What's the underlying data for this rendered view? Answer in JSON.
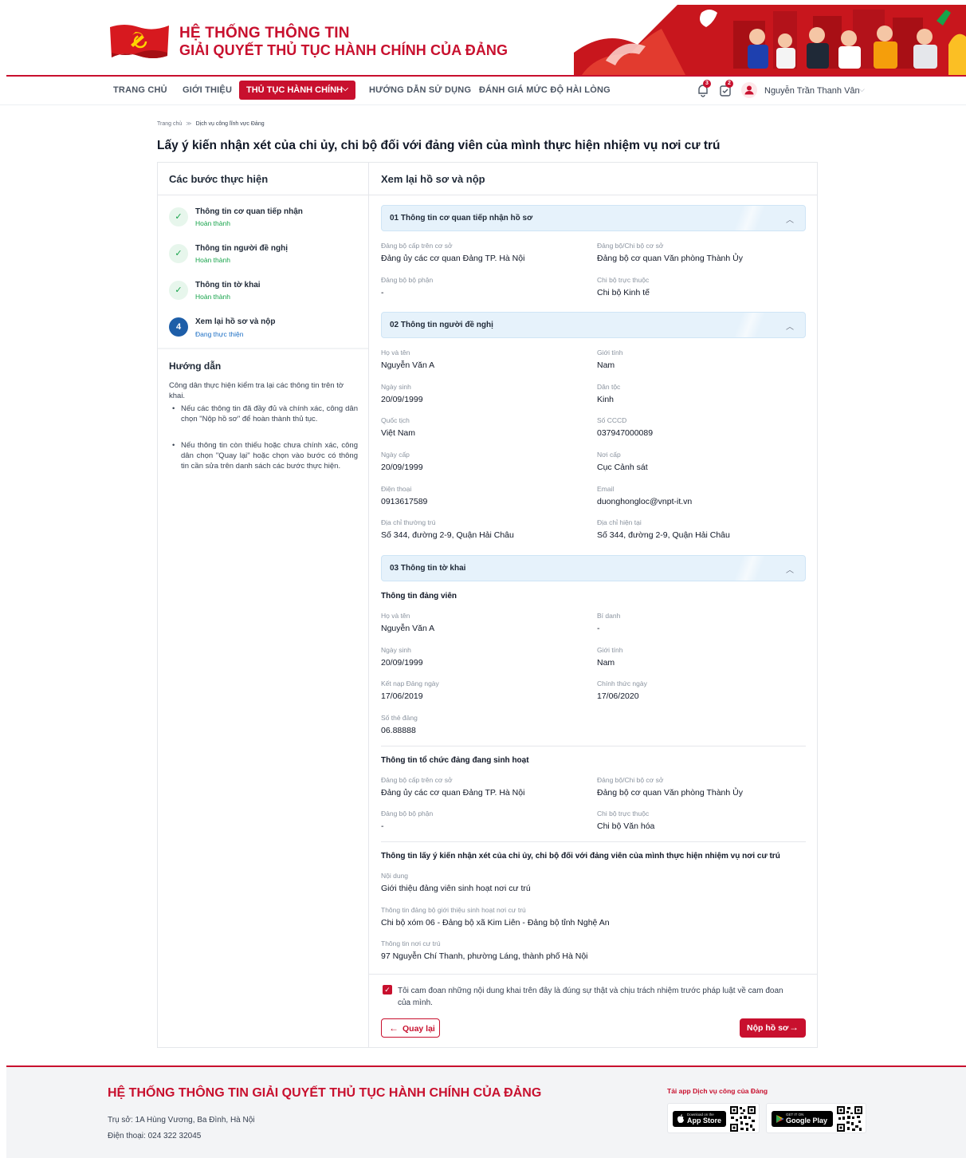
{
  "header": {
    "title_line1": "HỆ THỐNG THÔNG TIN",
    "title_line2": "GIẢI QUYẾT THỦ TỤC HÀNH CHÍNH CỦA ĐẢNG"
  },
  "nav": {
    "items": [
      "TRANG CHỦ",
      "GIỚI THIỆU",
      "THỦ TỤC HÀNH CHÍNH",
      "HƯỚNG DẪN SỬ DỤNG",
      "ĐÁNH GIÁ MỨC ĐỘ HÀI LÒNG"
    ],
    "notification_count": "3",
    "task_count": "2",
    "user_name": "Nguyễn Trần Thanh Vân"
  },
  "breadcrumb": {
    "home": "Trang chủ",
    "separator": "≫",
    "current": "Dịch vụ công lĩnh vực Đảng"
  },
  "page_title": "Lấy ý kiến nhận xét của chi ủy, chi bộ đối với đảng viên của mình thực hiện nhiệm vụ nơi cư trú",
  "steps_panel": {
    "title": "Các bước thực hiện",
    "steps": [
      {
        "index": "✓",
        "title": "Thông tin cơ quan tiếp nhận",
        "status": "Hoàn thành"
      },
      {
        "index": "✓",
        "title": "Thông tin người đề nghị",
        "status": "Hoàn thành"
      },
      {
        "index": "✓",
        "title": "Thông tin tờ khai",
        "status": "Hoàn thành"
      },
      {
        "index": "4",
        "title": "Xem lại hồ sơ và nộp",
        "status": "Đang thực thiện"
      }
    ]
  },
  "guide": {
    "title": "Hướng dẫn",
    "intro": "Công dân thực hiện kiểm tra lại các thông tin trên tờ khai.",
    "bullets": [
      "Nếu các thông tin đã đầy đủ và chính xác, công dân chọn \"Nộp hồ sơ\" để hoàn thành thủ tục.",
      "Nếu thông tin còn thiếu hoặc chưa chính xác, công dân chọn \"Quay lại\" hoặc chọn vào bước có thông tin cần sửa trên danh sách các bước thực hiện."
    ]
  },
  "review": {
    "title": "Xem lại hồ sơ và nộp",
    "section1": {
      "label": "01  Thông tin cơ quan tiếp nhận hồ sơ",
      "fields": [
        {
          "label": "Đảng bộ cấp trên cơ sở",
          "value": "Đảng ủy các cơ quan Đảng TP. Hà Nội"
        },
        {
          "label": "Đảng bộ/Chi bộ cơ sở",
          "value": "Đảng bộ cơ quan Văn phòng Thành Ủy"
        },
        {
          "label": "Đảng bộ bộ phận",
          "value": "-"
        },
        {
          "label": "Chi bộ trực thuộc",
          "value": "Chi bộ Kinh tế"
        }
      ]
    },
    "section2": {
      "label": "02  Thông tin người đề nghị",
      "fields": [
        {
          "label": "Họ và tên",
          "value": "Nguyễn Văn A"
        },
        {
          "label": "Giới tính",
          "value": "Nam"
        },
        {
          "label": "Ngày sinh",
          "value": "20/09/1999"
        },
        {
          "label": "Dân tộc",
          "value": "Kinh"
        },
        {
          "label": "Quốc tịch",
          "value": "Việt Nam"
        },
        {
          "label": "Số CCCD",
          "value": "037947000089"
        },
        {
          "label": "Ngày cấp",
          "value": "20/09/1999"
        },
        {
          "label": "Nơi cấp",
          "value": "Cục Cảnh sát"
        },
        {
          "label": "Điện thoại",
          "value": "0913617589"
        },
        {
          "label": "Email",
          "value": "duonghongloc@vnpt-it.vn"
        },
        {
          "label": "Địa chỉ thường trú",
          "value": "Số 344, đường 2-9, Quận Hải Châu"
        },
        {
          "label": "Địa chỉ hiện tại",
          "value": "Số 344, đường 2-9, Quận Hải Châu"
        }
      ]
    },
    "section3": {
      "label": "03  Thông tin tờ khai",
      "member_heading": "Thông tin đảng viên",
      "member_fields": [
        {
          "label": "Họ và tên",
          "value": "Nguyễn Văn A"
        },
        {
          "label": "Bí danh",
          "value": "-"
        },
        {
          "label": "Ngày sinh",
          "value": "20/09/1999"
        },
        {
          "label": "Giới tính",
          "value": "Nam"
        },
        {
          "label": "Kết nạp Đảng ngày",
          "value": "17/06/2019"
        },
        {
          "label": "Chính thức ngày",
          "value": "17/06/2020"
        },
        {
          "label": "Số thẻ đảng",
          "value": "06.88888"
        }
      ],
      "org_heading": "Thông tin tổ chức đảng đang sinh hoạt",
      "org_fields": [
        {
          "label": "Đảng bộ cấp trên cơ sở",
          "value": "Đảng ủy các cơ quan Đảng TP. Hà Nội"
        },
        {
          "label": "Đảng bộ/Chi bộ cơ sở",
          "value": "Đảng bộ cơ quan Văn phòng Thành Ủy"
        },
        {
          "label": "Đảng bộ bộ phận",
          "value": "-"
        },
        {
          "label": "Chi bộ trực thuộc",
          "value": "Chi bộ Văn hóa"
        }
      ],
      "opinion_heading": "Thông tin lấy ý kiến nhận xét của chi ủy, chi bộ đối với đảng viên của mình thực hiện nhiệm vụ nơi cư trú",
      "opinion_fields": [
        {
          "label": "Nội dung",
          "value": "Giới thiệu đảng viên sinh hoạt nơi cư trú"
        },
        {
          "label": "Thông tin đảng bộ giới thiệu sinh hoạt nơi cư trú",
          "value": "Chi bộ xóm 06 - Đảng bộ xã Kim Liên - Đảng bộ tỉnh Nghệ An"
        },
        {
          "label": "Thông tin nơi cư trú",
          "value": "97 Nguyễn Chí Thanh, phường Láng, thành phố Hà Nội"
        }
      ]
    },
    "declaration": "Tôi cam đoan những nội dung khai trên đây là đúng sự thật và chịu trách nhiệm trước pháp luật về cam đoan của mình.",
    "declaration_checked": true,
    "back_label": "Quay lại",
    "submit_label": "Nộp hồ sơ"
  },
  "footer": {
    "title": "HỆ THỐNG THÔNG TIN GIẢI QUYẾT THỦ TỤC HÀNH CHÍNH CỦA ĐẢNG",
    "address": "Trụ sở: 1A Hùng Vương, Ba Đình, Hà Nội",
    "phone": "Điện thoại: 024 322 32045",
    "app_label": "Tải app Dịch vụ công của Đảng",
    "appstore_small": "Download on the",
    "appstore_big": "App Store",
    "googleplay_small": "GET IT ON",
    "googleplay_big": "Google Play"
  },
  "colors": {
    "brand": "#c8102e",
    "section_bg": "#e6f2fb",
    "success": "#16a34a",
    "active_step": "#1d5ea8"
  }
}
